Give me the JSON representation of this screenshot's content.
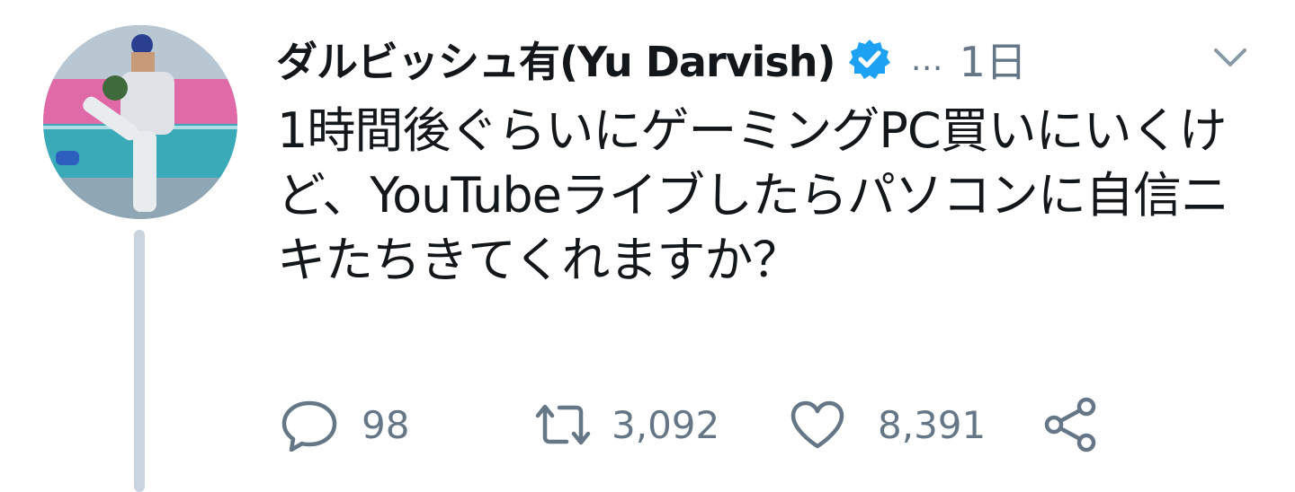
{
  "author": {
    "display_name": "ダルビッシュ有(Yu Darvish)",
    "verified": true,
    "handle_truncated": "…",
    "timestamp": "1日"
  },
  "tweet": {
    "text": "1時間後ぐらいにゲーミングPC買いにいくけど、YouTubeライブしたらパソコンに自信ニキたちきてくれますか？"
  },
  "actions": {
    "reply": {
      "icon": "reply-icon",
      "count": "98"
    },
    "retweet": {
      "icon": "retweet-icon",
      "count": "3,092"
    },
    "like": {
      "icon": "heart-icon",
      "count": "8,391"
    },
    "share": {
      "icon": "share-icon"
    }
  },
  "colors": {
    "text": "#14171a",
    "secondary": "#657786",
    "verified_blue": "#1da1f2",
    "thread_line": "#c9d4de"
  }
}
